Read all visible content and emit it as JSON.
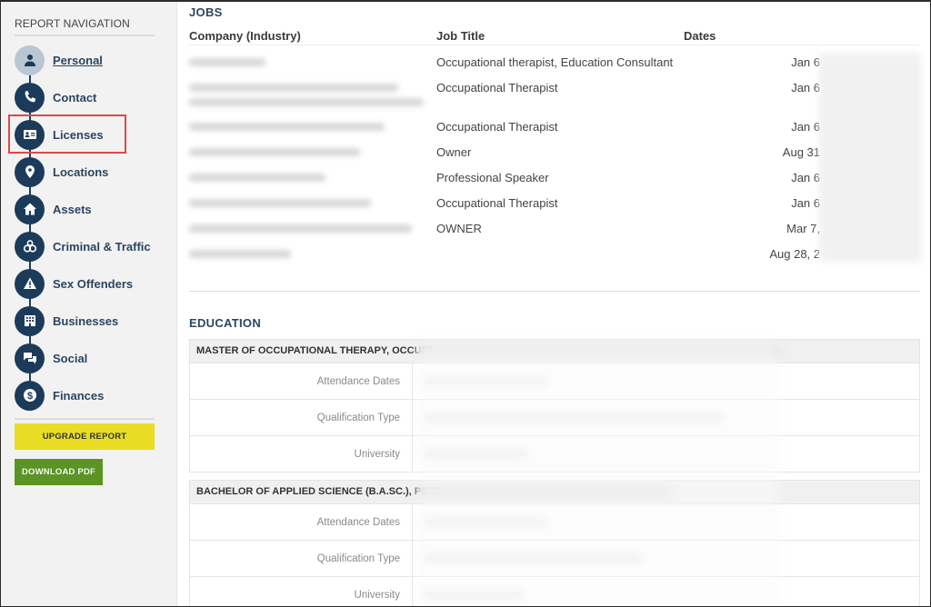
{
  "sidebar": {
    "title": "REPORT NAVIGATION",
    "items": [
      {
        "label": "Personal",
        "icon": "person-icon",
        "active": true
      },
      {
        "label": "Contact",
        "icon": "phone-icon"
      },
      {
        "label": "Licenses",
        "icon": "id-card-icon",
        "highlighted": true
      },
      {
        "label": "Locations",
        "icon": "map-pin-icon"
      },
      {
        "label": "Assets",
        "icon": "home-icon"
      },
      {
        "label": "Criminal & Traffic",
        "icon": "handcuffs-icon"
      },
      {
        "label": "Sex Offenders",
        "icon": "warning-icon"
      },
      {
        "label": "Businesses",
        "icon": "building-icon"
      },
      {
        "label": "Social",
        "icon": "chat-bubbles-icon"
      },
      {
        "label": "Finances",
        "icon": "dollar-icon"
      }
    ],
    "upgrade_label": "UPGRADE REPORT",
    "download_label": "DOWNLOAD PDF"
  },
  "jobs": {
    "title": "JOBS",
    "columns": [
      "Company (Industry)",
      "Job Title",
      "Dates"
    ],
    "rows": [
      {
        "company": "[redacted]",
        "title": "Occupational therapist, Education Consultant",
        "date": "Jan 6"
      },
      {
        "company": "[redacted]",
        "title": "Occupational Therapist",
        "date": "Jan 6"
      },
      {
        "company": "[redacted]",
        "title": "Occupational Therapist",
        "date": "Jan 6"
      },
      {
        "company": "[redacted]",
        "title": "Owner",
        "date": "Aug 31"
      },
      {
        "company": "[redacted]",
        "title": "Professional Speaker",
        "date": "Jan 6"
      },
      {
        "company": "[redacted]",
        "title": "Occupational Therapist",
        "date": "Jan 6"
      },
      {
        "company": "[redacted]",
        "title": "OWNER",
        "date": "Mar 7,"
      },
      {
        "company": "[redacted]",
        "title": "",
        "date": "Aug 28, 2"
      }
    ]
  },
  "education": {
    "title": "EDUCATION",
    "entries": [
      {
        "degree": "MASTER OF OCCUPATIONAL THERAPY, OCCUPA",
        "fields": [
          {
            "label": "Attendance Dates",
            "value": "[redacted]"
          },
          {
            "label": "Qualification Type",
            "value": "[redacted]"
          },
          {
            "label": "University",
            "value": "[redacted]"
          }
        ]
      },
      {
        "degree": "BACHELOR OF APPLIED SCIENCE (B.A.SC.), PSYC",
        "fields": [
          {
            "label": "Attendance Dates",
            "value": "[redacted]"
          },
          {
            "label": "Qualification Type",
            "value": "[redacted]"
          },
          {
            "label": "University",
            "value": "[redacted]"
          }
        ]
      }
    ]
  },
  "colors": {
    "nav_accent": "#1c3b5a",
    "highlight": "#e0474c",
    "upgrade": "#e8dd24",
    "download": "#5b9424"
  }
}
